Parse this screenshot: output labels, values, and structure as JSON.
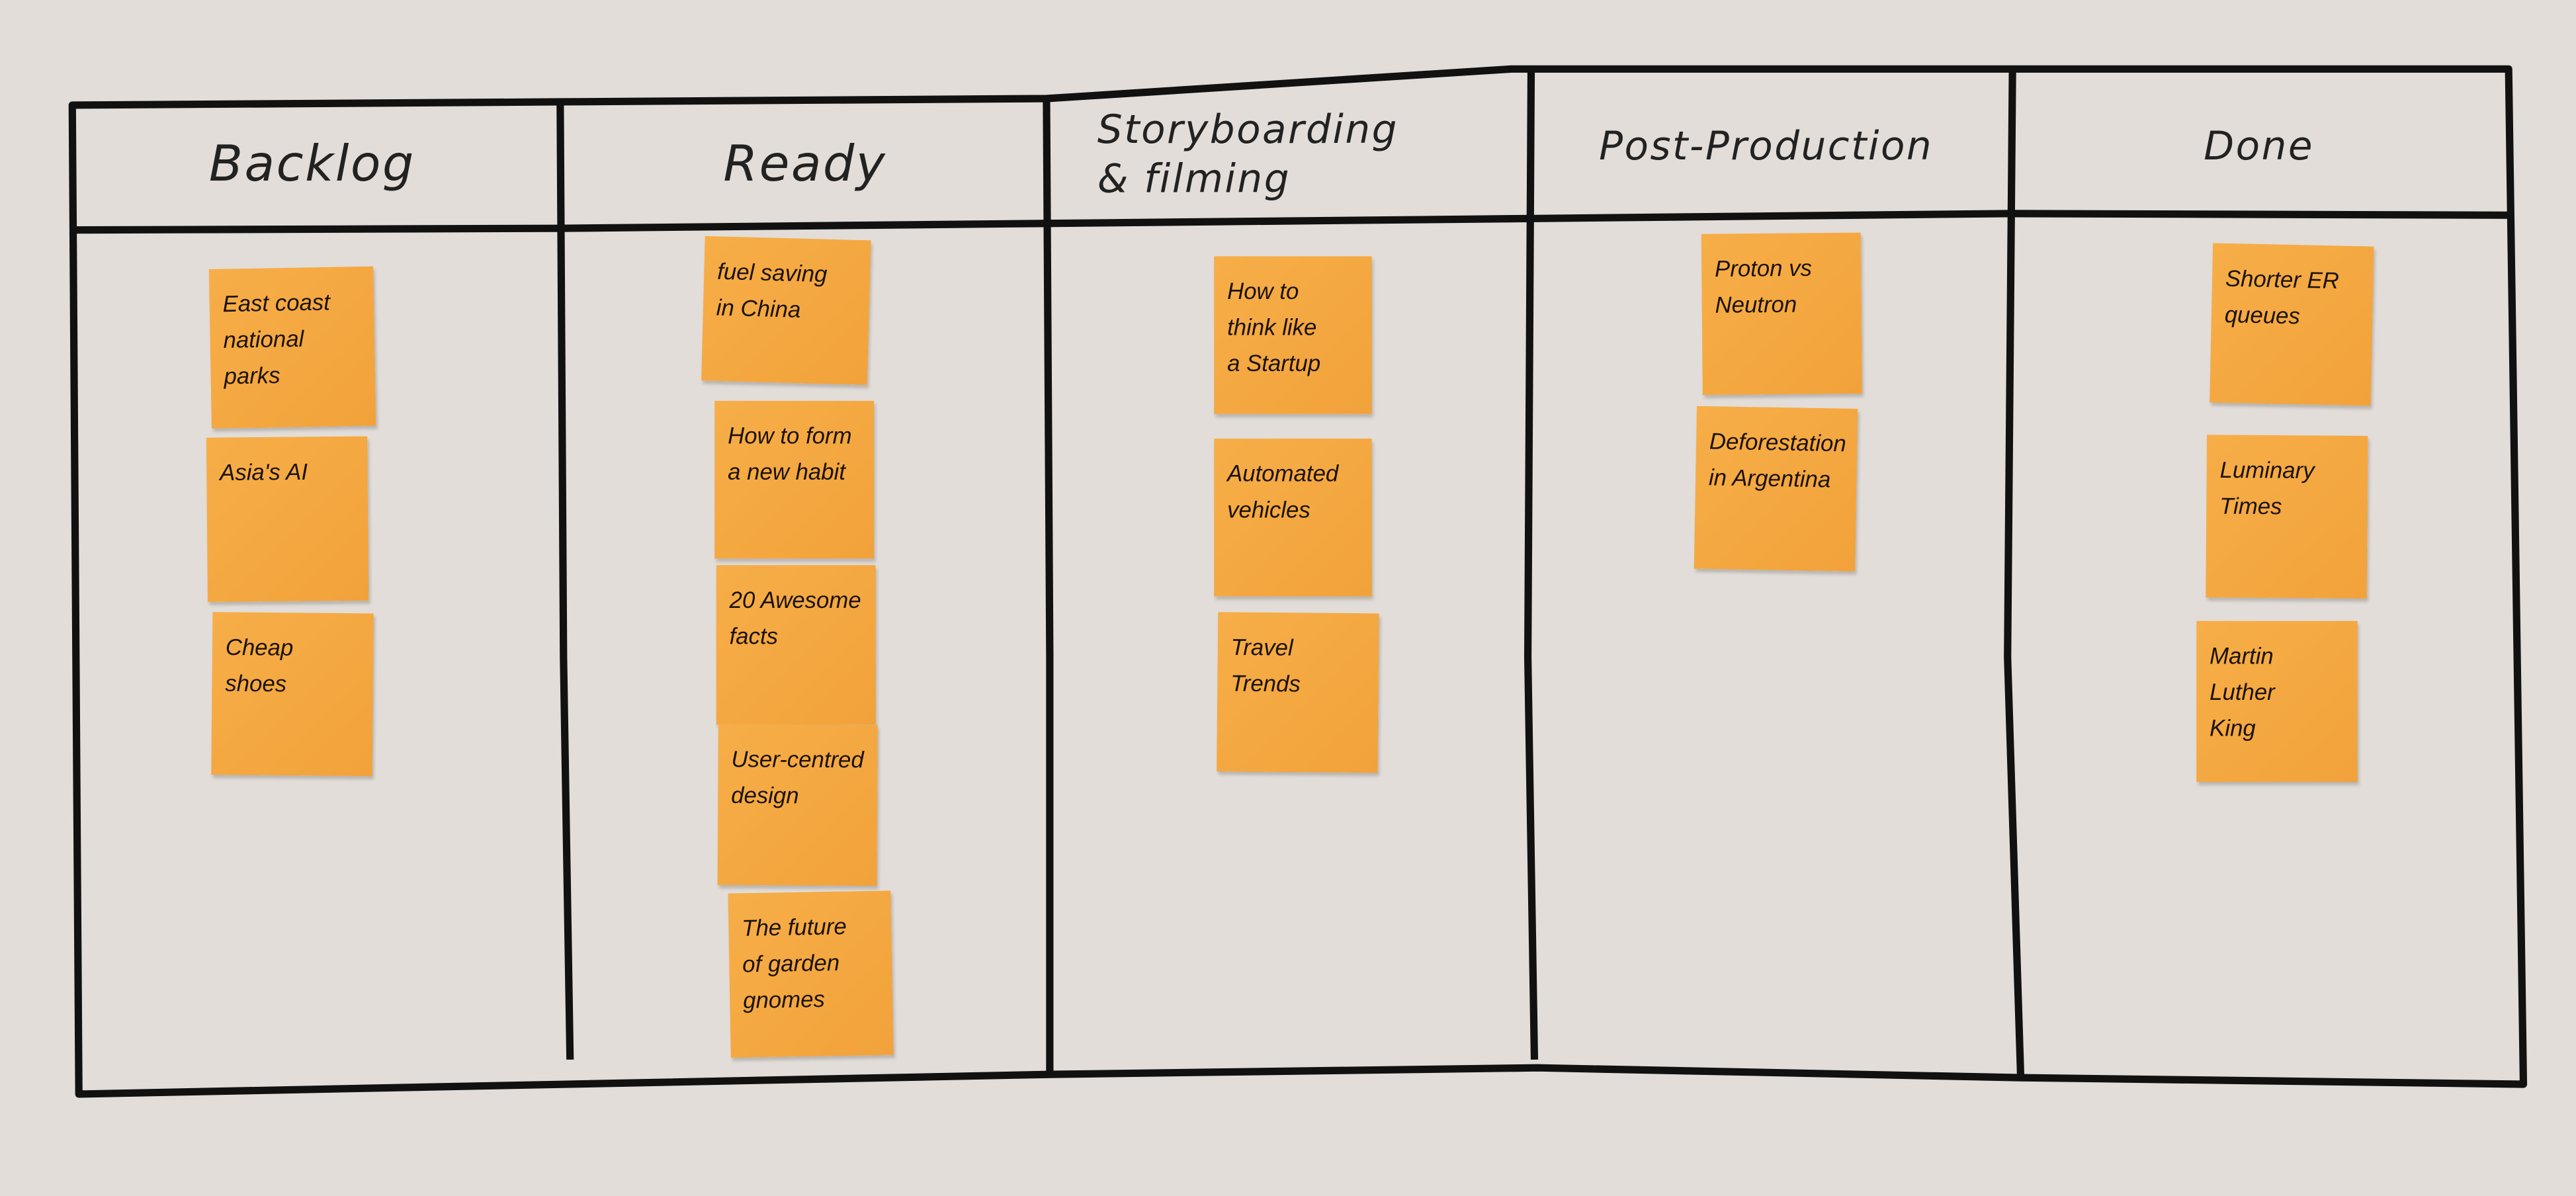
{
  "board": {
    "columns": [
      {
        "title": "Backlog",
        "cards": [
          "East coast\nnational\nparks",
          "Asia's AI",
          "Cheap\nshoes"
        ]
      },
      {
        "title": "Ready",
        "cards": [
          "fuel saving\nin China",
          "How to form\na new habit",
          "20 Awesome\nfacts",
          "User-centred\ndesign",
          "The future\nof garden\ngnomes"
        ]
      },
      {
        "title": "Storyboarding\n& filming",
        "cards": [
          "How to\nthink like\na Startup",
          "Automated\nvehicles",
          "Travel\nTrends"
        ]
      },
      {
        "title": "Post-Production",
        "cards": [
          "Proton vs\nNeutron",
          "Deforestation\nin Argentina"
        ]
      },
      {
        "title": "Done",
        "cards": [
          "Shorter ER\nqueues",
          "Luminary\nTimes",
          "Martin\nLuther\nKing"
        ]
      }
    ],
    "colors": {
      "background": "#e2ddd8",
      "sticky_note": "#f5a843",
      "ink": "#111111"
    }
  }
}
